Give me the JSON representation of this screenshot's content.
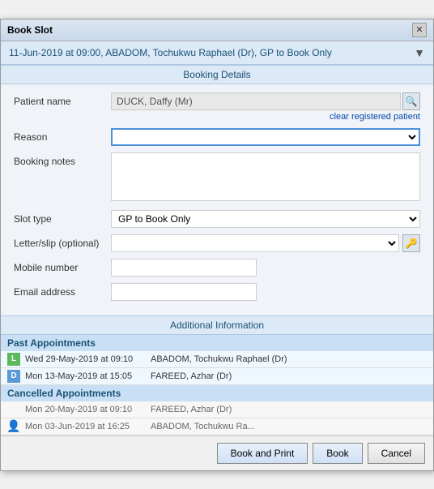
{
  "window": {
    "title": "Book Slot",
    "close_label": "✕"
  },
  "info_bar": {
    "text": "11-Jun-2019 at 09:00, ABADOM, Tochukwu Raphael (Dr), GP to Book Only",
    "expand_icon": "▼"
  },
  "sections": {
    "booking_details": "Booking Details",
    "additional_information": "Additional Information"
  },
  "form": {
    "patient_name_label": "Patient name",
    "patient_name_value": "DUCK, Daffy (Mr)",
    "clear_link": "clear registered patient",
    "reason_label": "Reason",
    "reason_placeholder": "",
    "booking_notes_label": "Booking notes",
    "slot_type_label": "Slot type",
    "slot_type_value": "GP to Book Only",
    "letter_label": "Letter/slip (optional)",
    "mobile_label": "Mobile number",
    "email_label": "Email address",
    "search_icon": "🔍",
    "key_icon": "🔑"
  },
  "past_appointments": {
    "section_title": "Past Appointments",
    "items": [
      {
        "icon": "L",
        "icon_type": "green",
        "datetime": "Wed 29-May-2019 at 09:10",
        "name": "ABADOM, Tochukwu Raphael (Dr)"
      },
      {
        "icon": "D",
        "icon_type": "blue",
        "datetime": "Mon 13-May-2019 at 15:05",
        "name": "FAREED, Azhar (Dr)"
      }
    ]
  },
  "cancelled_appointments": {
    "section_title": "Cancelled Appointments",
    "items": [
      {
        "icon": "",
        "icon_type": "none",
        "datetime": "Mon 20-May-2019 at 09:10",
        "name": "FAREED, Azhar (Dr)"
      },
      {
        "icon": "👤",
        "icon_type": "person",
        "datetime": "Mon 03-Jun-2019 at 16:25",
        "name": "ABADOM, Tochukwu Ra..."
      }
    ]
  },
  "footer_buttons": {
    "book_and_print": "Book and Print",
    "book": "Book",
    "cancel": "Cancel"
  }
}
